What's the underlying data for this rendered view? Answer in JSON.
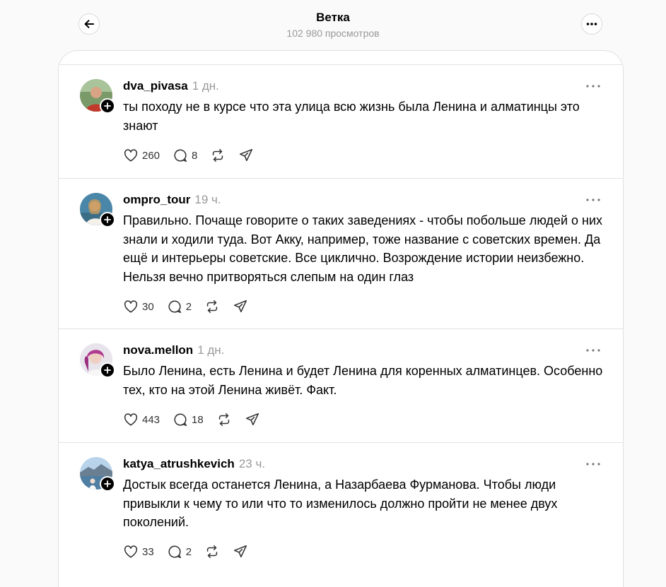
{
  "header": {
    "title": "Ветка",
    "views": "102 980 просмотров"
  },
  "icons": {
    "back": "arrow-left-icon",
    "more": "more-horizontal-icon",
    "like": "heart-icon",
    "reply": "comment-icon",
    "repost": "repost-icon",
    "share": "send-icon",
    "follow": "plus-icon"
  },
  "posts": [
    {
      "username": "dva_pivasa",
      "time": "1 дн.",
      "text": "ты походу не в курсе что эта улица всю жизнь была Ленина и алматинцы это знают",
      "likes": "260",
      "replies": "8"
    },
    {
      "username": "ompro_tour",
      "time": "19 ч.",
      "text": "Правильно. Почаще говорите о таких заведениях - чтобы побольше людей о них знали и ходили туда. Вот Акку, например, тоже название с советских времен. Да ещё и интерьеры советские. Все циклично. Возрождение истории неизбежно. Нельзя вечно притворяться слепым на один глаз",
      "likes": "30",
      "replies": "2"
    },
    {
      "username": "nova.mellon",
      "time": "1 дн.",
      "text": "Было Ленина, есть Ленина и будет Ленина для коренных алматинцев. Особенно тех, кто на этой Ленина живёт. Факт.",
      "likes": "443",
      "replies": "18"
    },
    {
      "username": "katya_atrushkevich",
      "time": "23 ч.",
      "text": "Достык всегда останется Ленина, а Назарбаева Фурманова. Чтобы люди привыкли к чему то или что то изменилось должно пройти не менее двух поколений.",
      "likes": "33",
      "replies": "2"
    }
  ]
}
